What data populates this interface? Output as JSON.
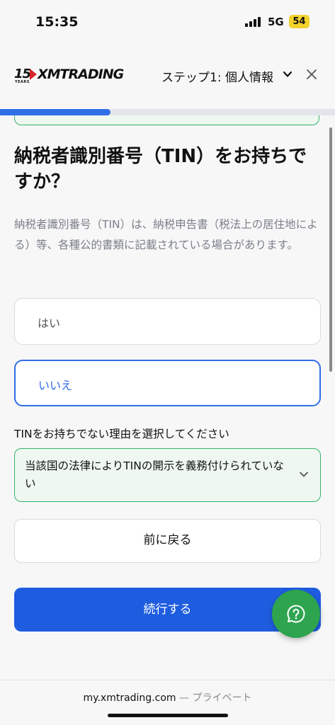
{
  "status_bar": {
    "time": "15:35",
    "network": "5G",
    "battery": "54"
  },
  "header": {
    "logo_number": "15",
    "logo_years": "YEARS",
    "logo_text": "XMTRADING",
    "step_title": "ステップ1: 個人情報",
    "icons": [
      "chevron-down-icon",
      "close-icon"
    ]
  },
  "progress": {
    "fraction": 0.33,
    "color": "#2f6ee6"
  },
  "question": {
    "title": "納税者識別番号（TIN）をお持ちですか？",
    "description": "納税者識別番号（TIN）は、納税申告書（税法上の居住地による）等、各種公的書類に記載されている場合があります。",
    "options": [
      {
        "label": "はい",
        "selected": false
      },
      {
        "label": "いいえ",
        "selected": true
      }
    ]
  },
  "reason": {
    "label": "TINをお持ちでない理由を選択してください",
    "selected_value": "当該国の法律によりTINの開示を義務付けられていない"
  },
  "buttons": {
    "back": "前に戻る",
    "continue": "続行する"
  },
  "browser": {
    "domain": "my.xmtrading.com",
    "separator": " — ",
    "mode": "プライベート"
  },
  "colors": {
    "primary": "#1f5de0",
    "selected_border": "#2f6ee6",
    "success_border": "#39b36a",
    "help_button": "#2ea44f",
    "logo_red": "#d7262b"
  }
}
